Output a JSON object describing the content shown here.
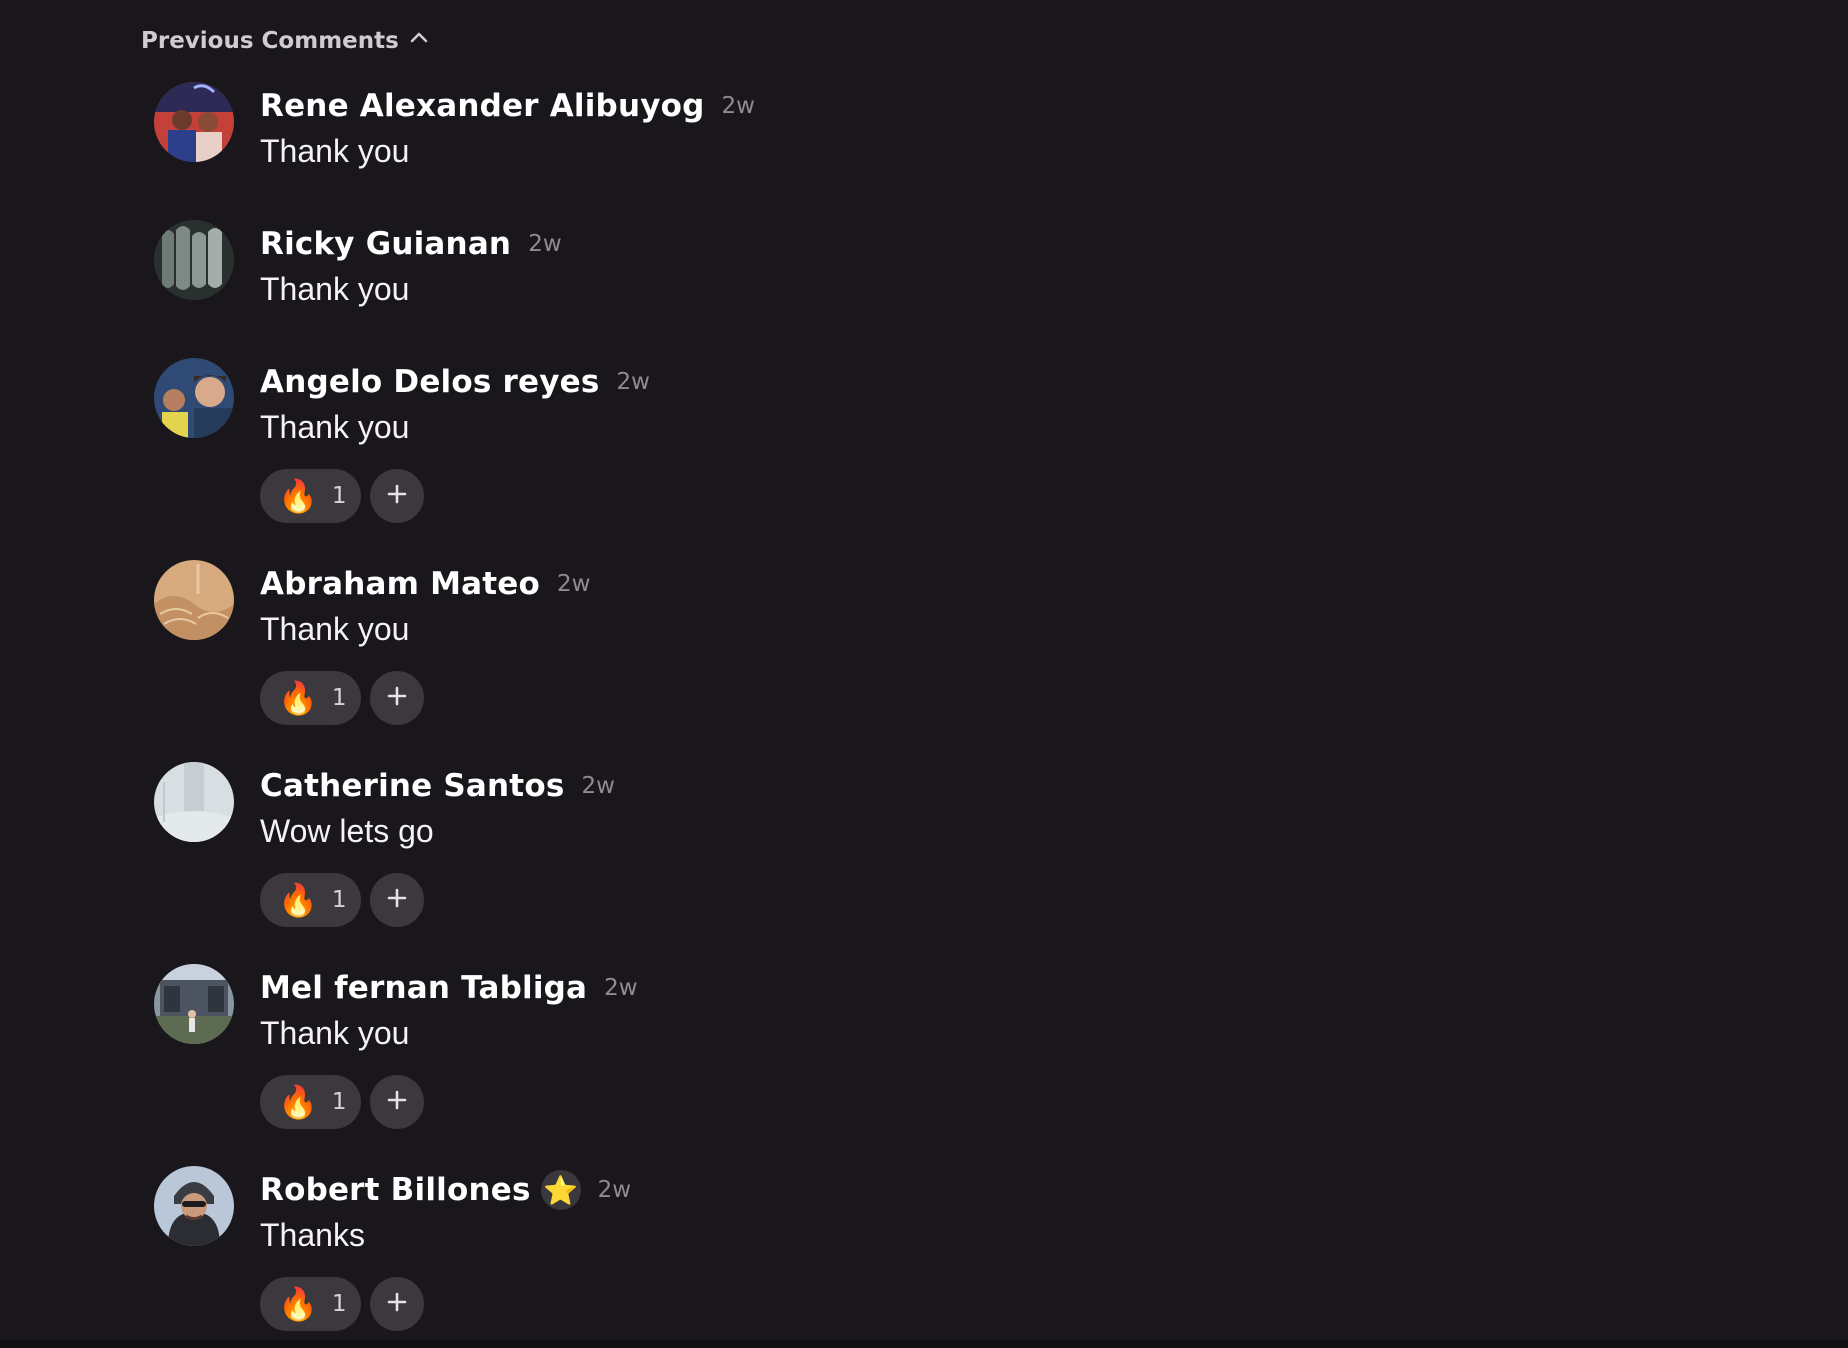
{
  "header": {
    "previous_comments_label": "Previous Comments"
  },
  "comments": [
    {
      "name": "Rene Alexander Alibuyog",
      "time": "2w",
      "text": "Thank you",
      "reactions": []
    },
    {
      "name": "Ricky Guianan",
      "time": "2w",
      "text": "Thank you",
      "reactions": []
    },
    {
      "name": "Angelo Delos reyes",
      "time": "2w",
      "text": "Thank you",
      "reactions": [
        {
          "emoji": "🔥",
          "count": "1"
        }
      ]
    },
    {
      "name": "Abraham Mateo",
      "time": "2w",
      "text": "Thank you",
      "reactions": [
        {
          "emoji": "🔥",
          "count": "1"
        }
      ]
    },
    {
      "name": "Catherine Santos",
      "time": "2w",
      "text": "Wow lets go",
      "reactions": [
        {
          "emoji": "🔥",
          "count": "1"
        }
      ]
    },
    {
      "name": "Mel fernan Tabliga",
      "time": "2w",
      "text": "Thank you",
      "reactions": [
        {
          "emoji": "🔥",
          "count": "1"
        }
      ]
    },
    {
      "name": "Robert Billones",
      "time": "2w",
      "text": "Thanks",
      "badge": "⭐",
      "reactions": [
        {
          "emoji": "🔥",
          "count": "1"
        }
      ]
    }
  ],
  "colors": {
    "background": "#19171b",
    "pill": "#3b383e",
    "name": "#ffffff",
    "timestamp": "#8f8a94"
  },
  "icons": {
    "toggle": "chevron-up-icon",
    "reaction": "fire-emoji",
    "add_reaction": "plus-icon",
    "badge": "star-icon"
  }
}
